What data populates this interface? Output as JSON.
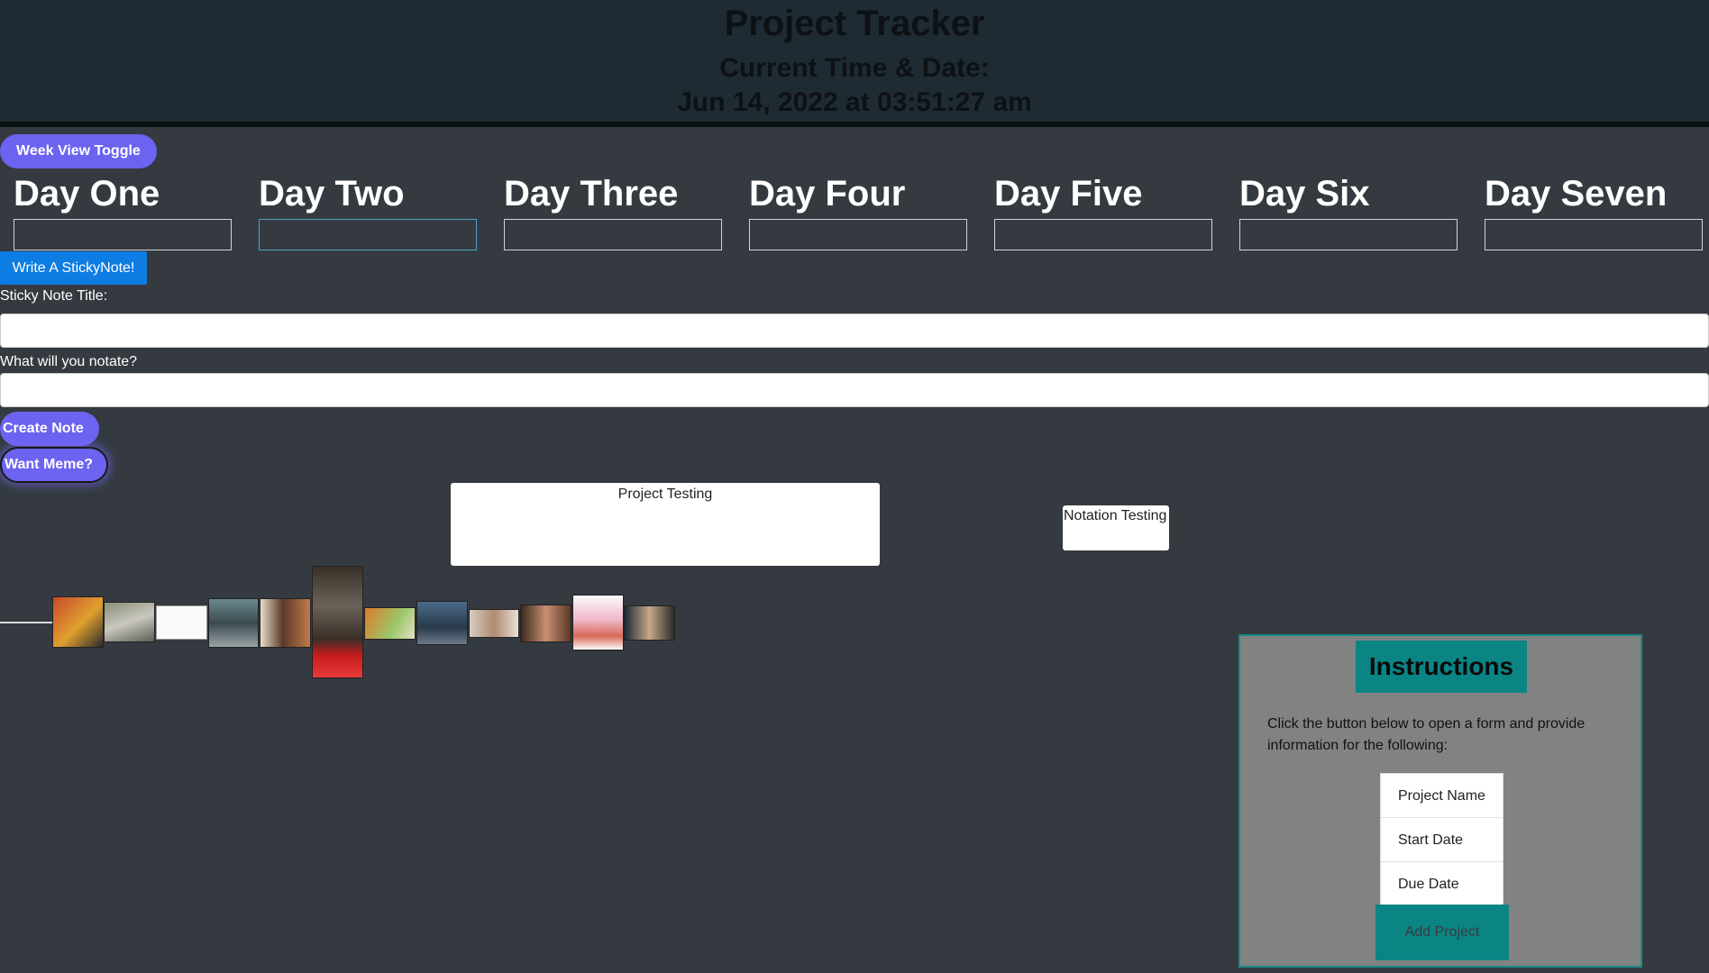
{
  "header": {
    "title": "Project Tracker",
    "time_label": "Current Time & Date:",
    "time_value": "Jun 14, 2022 at 03:51:27 am"
  },
  "week_toggle_label": "Week View Toggle",
  "days": [
    {
      "label": "Day One",
      "value": ""
    },
    {
      "label": "Day Two",
      "value": ""
    },
    {
      "label": "Day Three",
      "value": ""
    },
    {
      "label": "Day Four",
      "value": ""
    },
    {
      "label": "Day Five",
      "value": ""
    },
    {
      "label": "Day Six",
      "value": ""
    },
    {
      "label": "Day Seven",
      "value": ""
    }
  ],
  "sticky": {
    "button_label": "Write A StickyNote!",
    "title_label": "Sticky Note Title:",
    "title_value": "",
    "notate_label": "What will you notate?",
    "notate_value": "",
    "create_label": "Create Note"
  },
  "meme_button_label": "Want Meme?",
  "notes": [
    {
      "text": "Project Testing"
    },
    {
      "text": "Notation Testing"
    }
  ],
  "memes": [
    {
      "name": "meme-thumbnail-1"
    },
    {
      "name": "meme-thumbnail-2"
    },
    {
      "name": "meme-thumbnail-3"
    },
    {
      "name": "meme-thumbnail-4"
    },
    {
      "name": "meme-thumbnail-5"
    },
    {
      "name": "meme-thumbnail-6"
    },
    {
      "name": "meme-thumbnail-7"
    },
    {
      "name": "meme-thumbnail-8"
    },
    {
      "name": "meme-thumbnail-9"
    },
    {
      "name": "meme-thumbnail-10"
    },
    {
      "name": "meme-thumbnail-11"
    },
    {
      "name": "meme-thumbnail-12"
    }
  ],
  "instructions": {
    "title": "Instructions",
    "text": "Click the button below to open a form and provide information for the following:",
    "items": [
      "Project Name",
      "Start Date",
      "Due Date"
    ],
    "add_label": "Add Project"
  },
  "colors": {
    "page_bg": "#343a40",
    "header_bg": "#1e2b33",
    "pill_accent": "#6c63f0",
    "sticky_button": "#0d7de3",
    "instructions_accent": "#0b8484"
  }
}
